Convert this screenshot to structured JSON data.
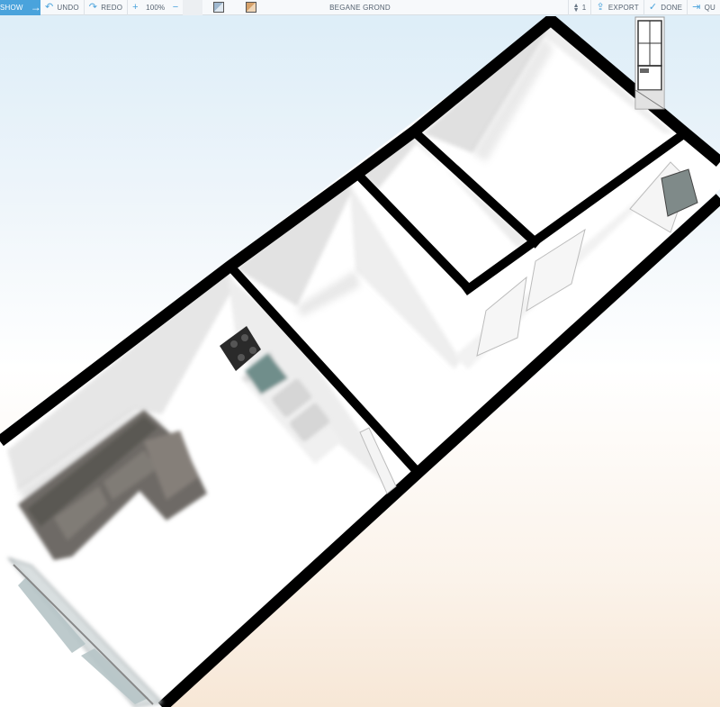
{
  "toolbar": {
    "show_label": "SHOW",
    "undo_label": "UNDO",
    "redo_label": "REDO",
    "zoom_value": "100%",
    "floor_name": "BEGANE GROND",
    "floor_count": "1",
    "export_label": "EXPORT",
    "done_label": "DONE",
    "quit_label": "QU"
  },
  "colors": {
    "accent": "#4aa3dc",
    "wall": "#000000",
    "floor": "#ffffff"
  }
}
